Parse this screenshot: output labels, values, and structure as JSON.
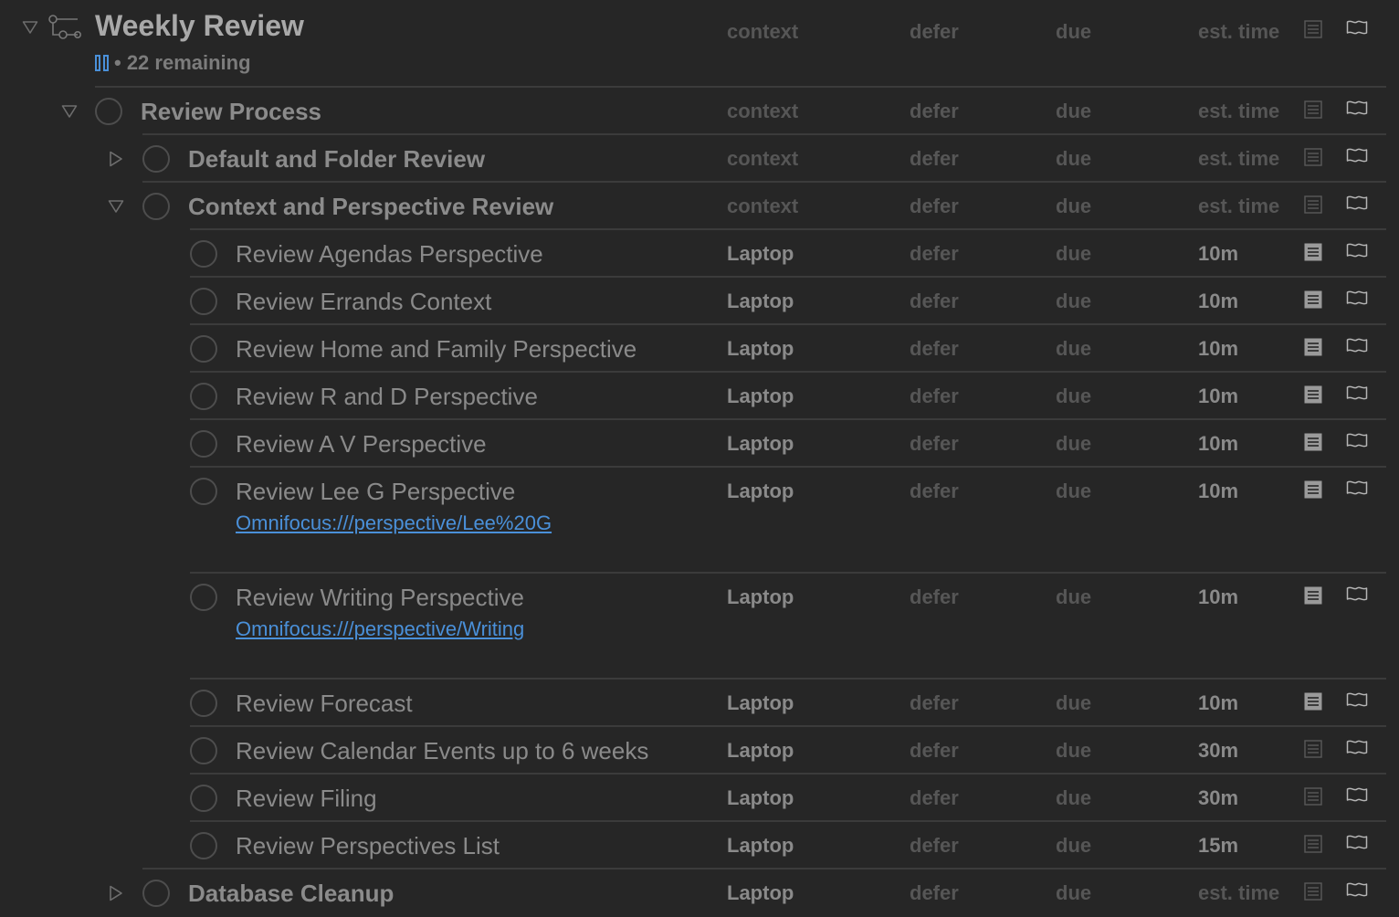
{
  "project": {
    "title": "Weekly Review",
    "remaining": "• 22 remaining",
    "status_icon": "pause-icon",
    "columns": {
      "context": "context",
      "defer": "defer",
      "due": "due",
      "est": "est. time"
    }
  },
  "rows": [
    {
      "kind": "group",
      "title": "Review Process",
      "context": "context",
      "defer": "defer",
      "due": "due",
      "est": "est. time",
      "expanded": true
    },
    {
      "kind": "group",
      "title": "Default and Folder Review",
      "context": "context",
      "defer": "defer",
      "due": "due",
      "est": "est. time",
      "expanded": false
    },
    {
      "kind": "group",
      "title": "Context and Perspective Review",
      "context": "context",
      "defer": "defer",
      "due": "due",
      "est": "est. time",
      "expanded": true
    },
    {
      "kind": "task",
      "title": "Review Agendas Perspective",
      "context": "Laptop",
      "defer": "defer",
      "due": "due",
      "est": "10m",
      "has_note": true
    },
    {
      "kind": "task",
      "title": "Review Errands Context",
      "context": "Laptop",
      "defer": "defer",
      "due": "due",
      "est": "10m",
      "has_note": true
    },
    {
      "kind": "task",
      "title": "Review Home and Family Perspective",
      "context": "Laptop",
      "defer": "defer",
      "due": "due",
      "est": "10m",
      "has_note": true
    },
    {
      "kind": "task",
      "title": "Review R and D Perspective",
      "context": "Laptop",
      "defer": "defer",
      "due": "due",
      "est": "10m",
      "has_note": true
    },
    {
      "kind": "task",
      "title": "Review A V Perspective",
      "context": "Laptop",
      "defer": "defer",
      "due": "due",
      "est": "10m",
      "has_note": true
    },
    {
      "kind": "task",
      "title": "Review Lee G Perspective",
      "context": "Laptop",
      "defer": "defer",
      "due": "due",
      "est": "10m",
      "has_note": true,
      "note_link": "Omnifocus:///perspective/Lee%20G"
    },
    {
      "kind": "task",
      "title": "Review Writing Perspective",
      "context": "Laptop",
      "defer": "defer",
      "due": "due",
      "est": "10m",
      "has_note": true,
      "note_link": "Omnifocus:///perspective/Writing"
    },
    {
      "kind": "task",
      "title": "Review Forecast",
      "context": "Laptop",
      "defer": "defer",
      "due": "due",
      "est": "10m",
      "has_note": true
    },
    {
      "kind": "task",
      "title": "Review Calendar Events up to 6 weeks",
      "context": "Laptop",
      "defer": "defer",
      "due": "due",
      "est": "30m",
      "has_note": false
    },
    {
      "kind": "task",
      "title": "Review Filing",
      "context": "Laptop",
      "defer": "defer",
      "due": "due",
      "est": "30m",
      "has_note": false
    },
    {
      "kind": "task",
      "title": "Review Perspectives List",
      "context": "Laptop",
      "defer": "defer",
      "due": "due",
      "est": "15m",
      "has_note": false
    },
    {
      "kind": "group",
      "title": "Database Cleanup",
      "context": "Laptop",
      "defer": "defer",
      "due": "due",
      "est": "est. time",
      "expanded": false
    }
  ],
  "colors": {
    "background": "#262626",
    "link": "#4a90d9",
    "separator": "#3b3b3b"
  }
}
